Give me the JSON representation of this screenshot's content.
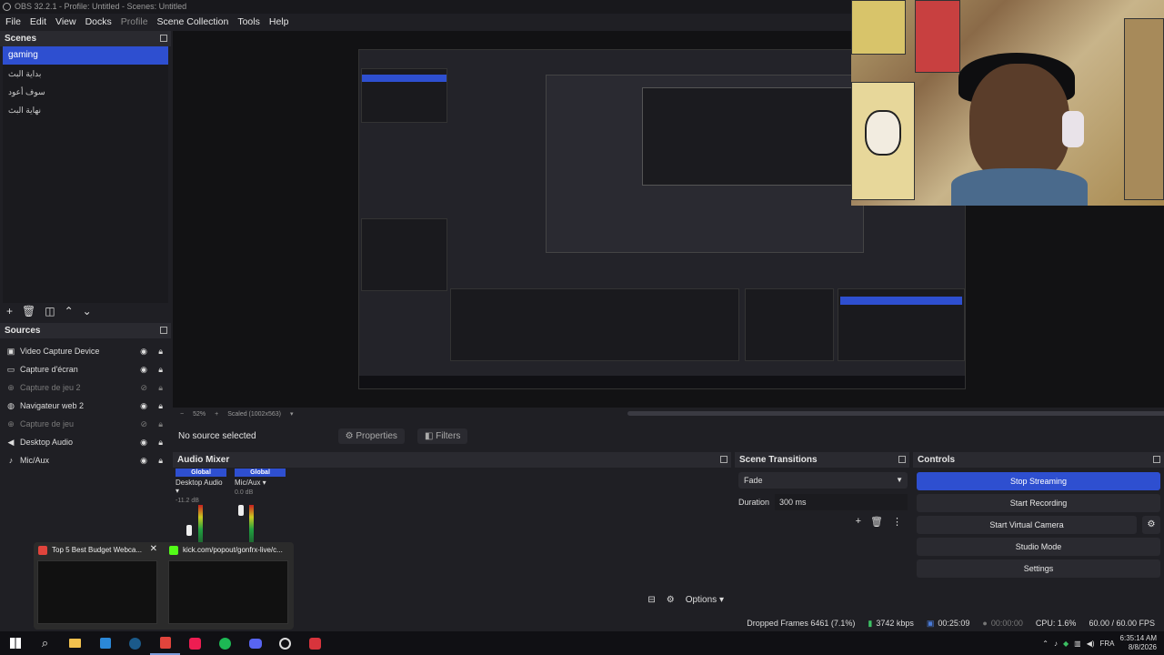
{
  "window": {
    "title": "OBS 32.2.1 - Profile: Untitled - Scenes: Untitled"
  },
  "menu": [
    "File",
    "Edit",
    "View",
    "Docks",
    "Profile",
    "Scene Collection",
    "Tools",
    "Help"
  ],
  "scenes": {
    "title": "Scenes",
    "items": [
      "gaming",
      "بداية البث",
      "سوف أعود",
      "نهاية البث"
    ],
    "selected": "gaming"
  },
  "sources": {
    "title": "Sources",
    "items": [
      {
        "label": "Video Capture Device",
        "icon": "camera-icon",
        "visible": true
      },
      {
        "label": "Capture d'écran",
        "icon": "monitor-icon",
        "visible": true
      },
      {
        "label": "Capture de jeu 2",
        "icon": "gamepad-icon",
        "visible": false
      },
      {
        "label": "Navigateur web 2",
        "icon": "globe-icon",
        "visible": true
      },
      {
        "label": "Capture de jeu",
        "icon": "gamepad-icon",
        "visible": false
      },
      {
        "label": "Desktop Audio",
        "icon": "speaker-icon",
        "visible": true
      },
      {
        "label": "Mic/Aux",
        "icon": "microphone-icon",
        "visible": true
      }
    ]
  },
  "preview": {
    "zoom": "52%",
    "scale_label": "Scaled (1002x563)"
  },
  "source_toolbar": {
    "no_source": "No source selected",
    "properties": "Properties",
    "filters": "Filters"
  },
  "mixer": {
    "title": "Audio Mixer",
    "channels": [
      {
        "badge": "Global",
        "name": "Desktop Audio",
        "db": "-11.2 dB"
      },
      {
        "badge": "Global",
        "name": "Mic/Aux",
        "db": "0.0 dB"
      }
    ],
    "options_label": "Options"
  },
  "transitions": {
    "title": "Scene Transitions",
    "selected": "Fade",
    "duration_label": "Duration",
    "duration_value": "300 ms"
  },
  "controls": {
    "title": "Controls",
    "stop_streaming": "Stop Streaming",
    "start_recording": "Start Recording",
    "start_virtual_camera": "Start Virtual Camera",
    "studio_mode": "Studio Mode",
    "settings": "Settings"
  },
  "status": {
    "dropped_frames": "Dropped Frames 6461 (7.1%)",
    "bitrate": "3742 kbps",
    "stream_time": "00:25:09",
    "record_time": "00:00:00",
    "cpu": "CPU: 1.6%",
    "fps": "60.00 / 60.00 FPS"
  },
  "taskbar_thumbs": [
    {
      "title": "Top 5 Best Budget Webca...",
      "icon_color": "#e0443c"
    },
    {
      "title": "kick.com/popout/gonfrx-live/c...",
      "icon_color": "#53fc18"
    }
  ],
  "tray": {
    "language": "FRA",
    "time": "6:35:14 AM",
    "date": "8/8/2026"
  },
  "colors": {
    "accent": "#2e4fd0",
    "panel_bg": "#1f1f24"
  }
}
